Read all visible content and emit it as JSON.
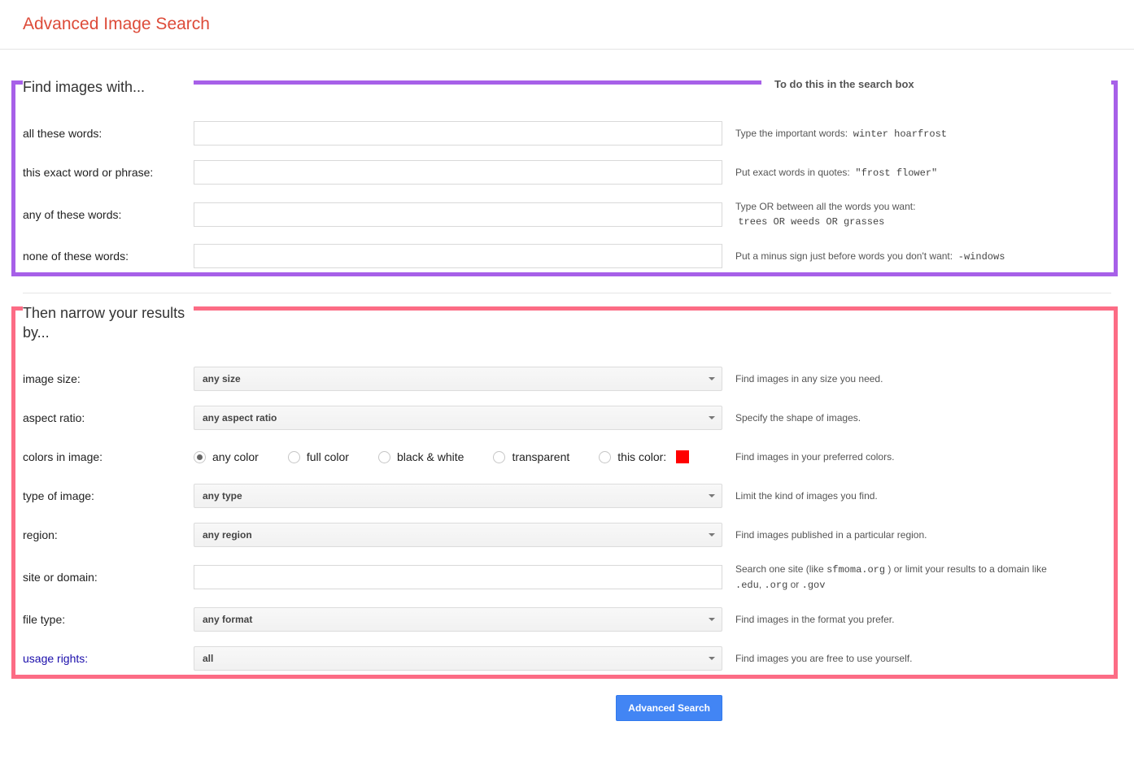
{
  "header": {
    "title": "Advanced Image Search"
  },
  "find": {
    "title": "Find images with...",
    "help_title": "To do this in the search box",
    "all_words": {
      "label": "all these words:",
      "value": "",
      "help_text": "Type the important words:",
      "help_code": "winter hoarfrost"
    },
    "exact": {
      "label": "this exact word or phrase:",
      "value": "",
      "help_text": "Put exact words in quotes:",
      "help_code": "\"frost flower\""
    },
    "any": {
      "label": "any of these words:",
      "value": "",
      "help_text": "Type OR between all the words you want:",
      "help_code": "trees OR weeds OR grasses"
    },
    "none": {
      "label": "none of these words:",
      "value": "",
      "help_text": "Put a minus sign just before words you don't want:",
      "help_code": "-windows"
    }
  },
  "narrow": {
    "title": "Then narrow your results by...",
    "image_size": {
      "label": "image size:",
      "value": "any size",
      "help": "Find images in any size you need."
    },
    "aspect_ratio": {
      "label": "aspect ratio:",
      "value": "any aspect ratio",
      "help": "Specify the shape of images."
    },
    "colors": {
      "label": "colors in image:",
      "help": "Find images in your preferred colors.",
      "options": {
        "any": "any color",
        "full": "full color",
        "bw": "black & white",
        "transparent": "transparent",
        "this": "this color:"
      },
      "selected": "any",
      "swatch_color": "#ff0000"
    },
    "type": {
      "label": "type of image:",
      "value": "any type",
      "help": "Limit the kind of images you find."
    },
    "region": {
      "label": "region:",
      "value": "any region",
      "help": "Find images published in a particular region."
    },
    "site": {
      "label": "site or domain:",
      "value": "",
      "help_pre": "Search one site (like ",
      "help_code1": "sfmoma.org",
      "help_mid": " ) or limit your results to a domain like ",
      "help_code2": ".edu",
      "help_sep1": ", ",
      "help_code3": ".org",
      "help_sep2": " or ",
      "help_code4": ".gov"
    },
    "file_type": {
      "label": "file type:",
      "value": "any format",
      "help": "Find images in the format you prefer."
    },
    "usage": {
      "label": "usage rights:",
      "value": "all",
      "help": "Find images you are free to use yourself."
    }
  },
  "submit": {
    "label": "Advanced Search"
  }
}
